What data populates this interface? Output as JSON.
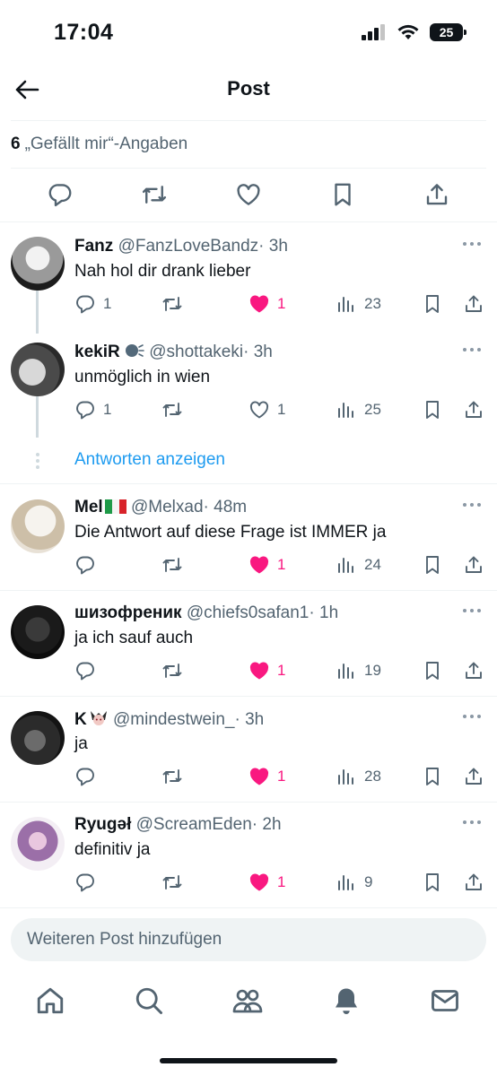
{
  "status_bar": {
    "time": "17:04",
    "battery": "25"
  },
  "header": {
    "title": "Post"
  },
  "likes": {
    "count": "6",
    "label": "„Gefällt mir“-Angaben"
  },
  "replies": [
    {
      "name": "Fanz",
      "handle": "@FanzLoveBandz",
      "time": "· 3h",
      "text": "Nah hol dir drank lieber",
      "replies": "1",
      "likes": "1",
      "liked": true,
      "views": "23"
    },
    {
      "name": "kekiR",
      "handle": "@shottakeki",
      "time": "· 3h",
      "text": "unmöglich in wien",
      "replies": "1",
      "likes": "1",
      "liked": false,
      "views": "25"
    },
    {
      "name": "Mel",
      "handle": "@Melxad",
      "time": "· 48m",
      "text": "Die Antwort auf diese Frage ist IMMER ja",
      "replies": "",
      "likes": "1",
      "liked": true,
      "views": "24"
    },
    {
      "name": "шизофреник",
      "handle": "@chiefs0safan1",
      "time": "· 1h",
      "text": "ja ich sauf auch",
      "replies": "",
      "likes": "1",
      "liked": true,
      "views": "19"
    },
    {
      "name": "K",
      "handle": "@mindestwein_",
      "time": "· 3h",
      "text": "ja",
      "replies": "",
      "likes": "1",
      "liked": true,
      "views": "28"
    },
    {
      "name": "Ryugəł",
      "handle": "@ScreamEden",
      "time": "· 2h",
      "text": "definitiv ja",
      "replies": "",
      "likes": "1",
      "liked": true,
      "views": "9"
    }
  ],
  "show_replies": "Antworten anzeigen",
  "compose": {
    "placeholder": "Weiteren Post hinzufügen"
  },
  "tabs": [
    "home-icon",
    "search-icon",
    "communities-icon",
    "notifications-icon",
    "messages-icon"
  ],
  "colors": {
    "like": "#f91880",
    "link": "#1d9bf0",
    "muted": "#536471"
  }
}
